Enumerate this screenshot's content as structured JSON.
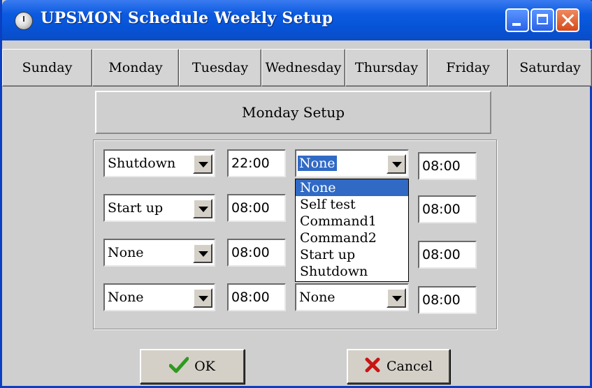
{
  "window": {
    "title": "UPSMON Schedule Weekly Setup"
  },
  "days": [
    "Sunday",
    "Monday",
    "Tuesday",
    "Wednesday",
    "Thursday",
    "Friday",
    "Saturday"
  ],
  "setup_title": "Monday Setup",
  "rows": [
    {
      "action": "Shutdown",
      "time1": "22:00",
      "action2": "None",
      "time2": "08:00"
    },
    {
      "action": "Start up",
      "time1": "08:00",
      "action2": "",
      "time2": "08:00"
    },
    {
      "action": "None",
      "time1": "08:00",
      "action2": "",
      "time2": "08:00"
    },
    {
      "action": "None",
      "time1": "08:00",
      "action2": "None",
      "time2": "08:00"
    }
  ],
  "dropdown_options": [
    "None",
    "Self test",
    "Command1",
    "Command2",
    "Start up",
    "Shutdown"
  ],
  "buttons": {
    "ok": "OK",
    "cancel": "Cancel"
  },
  "icons": {
    "app": "clock-icon",
    "ok": "check-icon",
    "cancel": "x-icon"
  },
  "colors": {
    "title_bar": "#0753d6",
    "selection": "#316ac5",
    "check": "#2e9a1e",
    "cancel_x": "#c81414"
  }
}
